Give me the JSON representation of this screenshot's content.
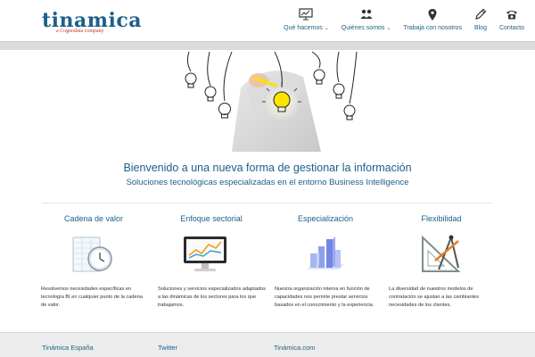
{
  "brand": {
    "logo_text": "tinamica",
    "logo_tagline": "a Cognodata company",
    "color": "#1d5f8a",
    "tagline_color": "#c0392b"
  },
  "nav": {
    "items": [
      {
        "label": "Qué hacemos",
        "icon": "monitor-icon",
        "has_caret": true
      },
      {
        "label": "Quiénes somos",
        "icon": "people-icon",
        "has_caret": true
      },
      {
        "label": "Trabaja con nosotros",
        "icon": "location-pin-icon",
        "has_caret": false
      },
      {
        "label": "Blog",
        "icon": "pen-icon",
        "has_caret": false
      },
      {
        "label": "Contacto",
        "icon": "phone-icon",
        "has_caret": false
      }
    ]
  },
  "hero": {
    "image": "lightbulb-drawing-illustration",
    "title": "Bienvenido a una nueva forma de gestionar la información",
    "subtitle": "Soluciones tecnológicas especializadas en el entorno Business Intelligence"
  },
  "features": [
    {
      "title": "Cadena de valor",
      "icon": "clock-spreadsheet-icon",
      "text": "Resolvemos necesidades específicas en tecnología BI en cualquier punto de la cadena de valor."
    },
    {
      "title": "Enfoque sectorial",
      "icon": "chart-monitor-icon",
      "text": "Soluciones y servicios especializados adaptados a las dinámicas de los sectores para los que trabajamos."
    },
    {
      "title": "Especialización",
      "icon": "bar-chart-3d-icon",
      "text": "Nuestra organización interna en función de capacidades nos permite prestar servicios basados en el conocimiento y la experiencia."
    },
    {
      "title": "Flexibilidad",
      "icon": "drafting-tools-icon",
      "text": "La diversidad de nuestros modelos de contratación se ajustan a las cambiantes necesidades de los clientes."
    }
  ],
  "footer": {
    "columns": [
      "Tinámica España",
      "Twitter",
      "Tinámica.com"
    ]
  }
}
